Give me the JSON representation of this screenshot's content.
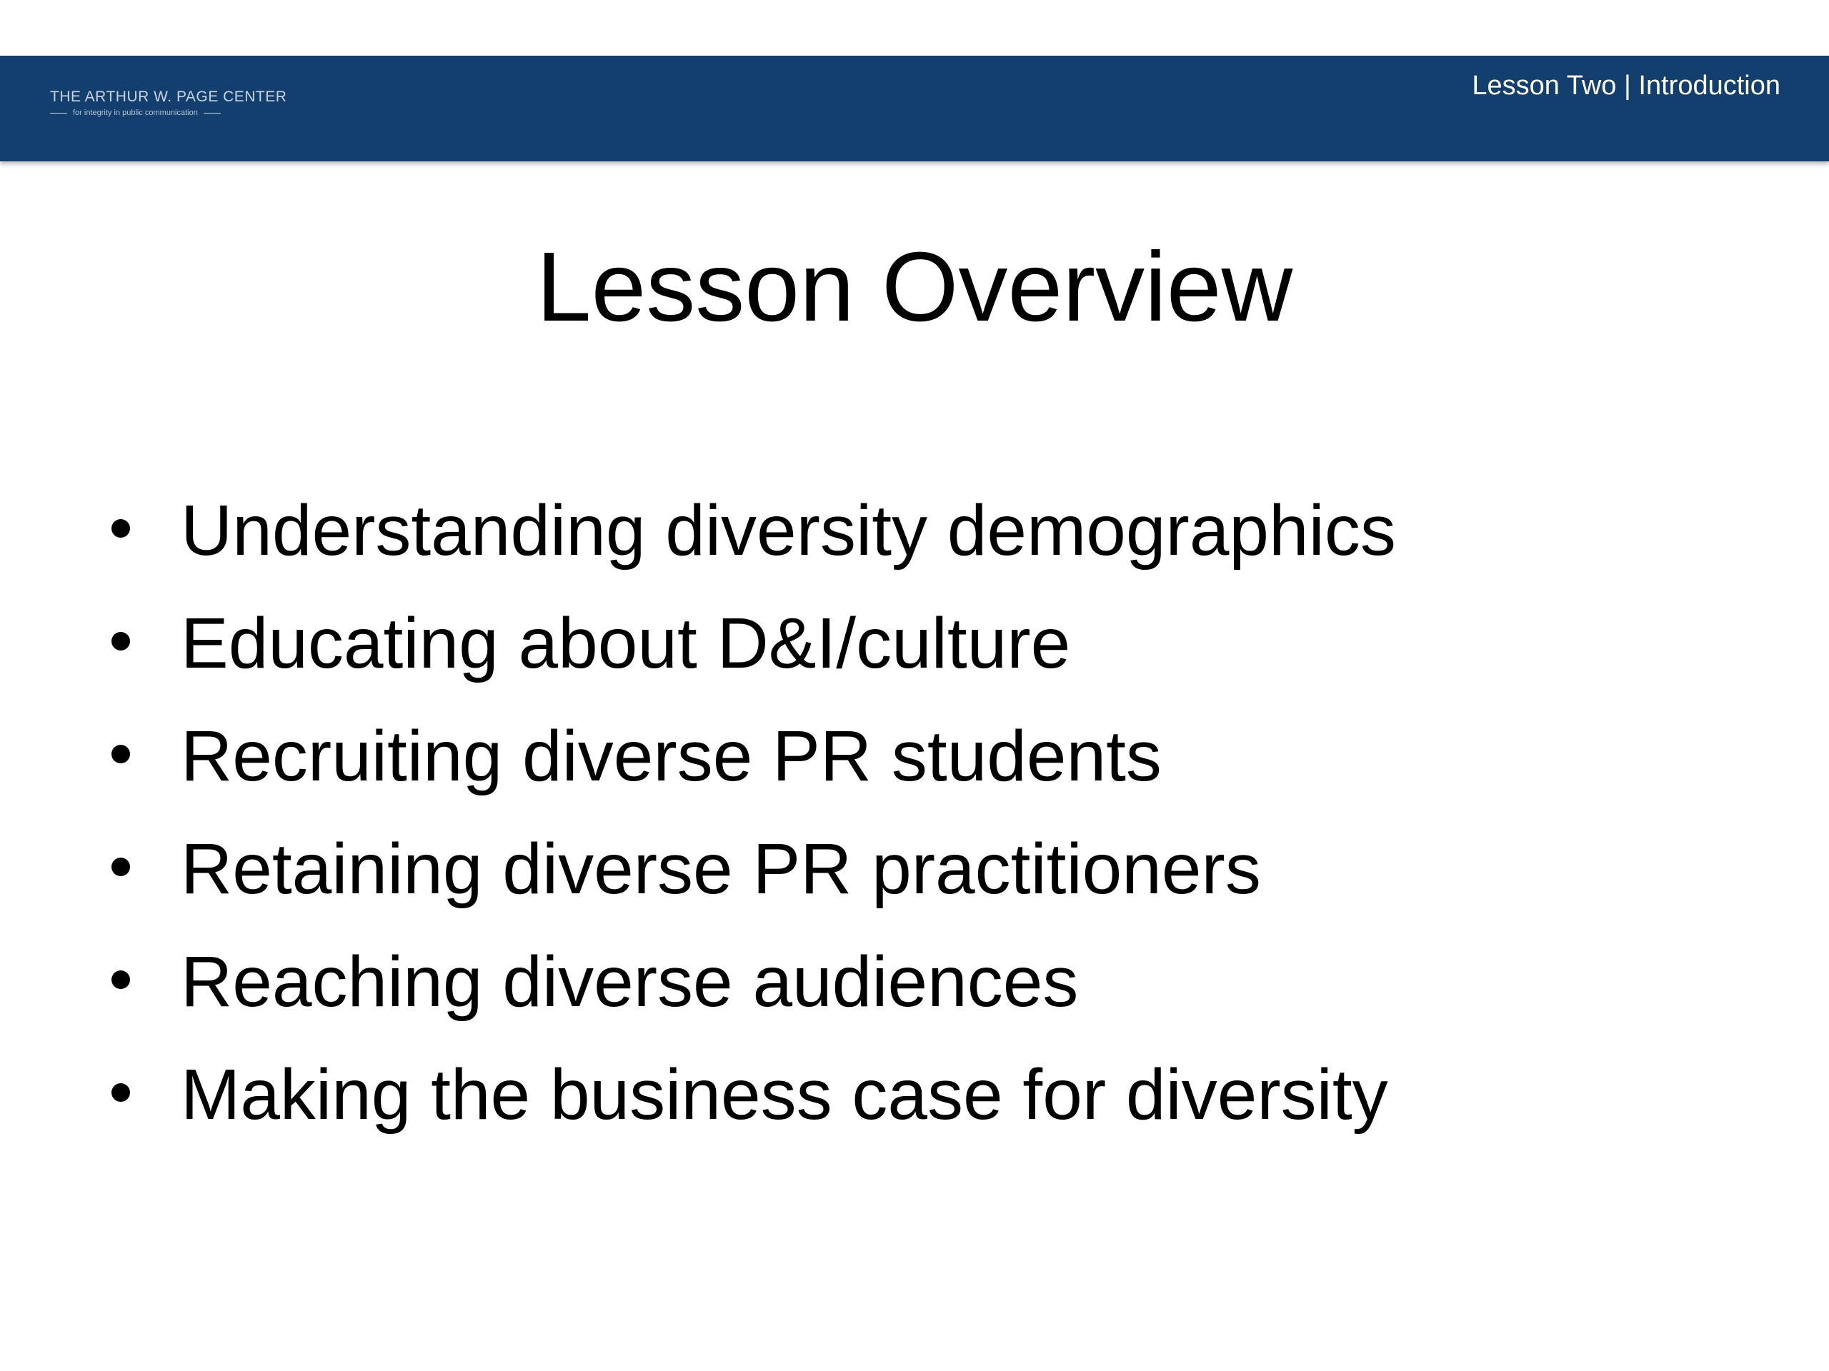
{
  "header": {
    "logo_name": "THE ARTHUR W. PAGE CENTER",
    "logo_tagline": "for integrity in public communication",
    "section_label": "Lesson Two | Introduction",
    "background_color": "#123f6e"
  },
  "slide": {
    "title": "Lesson Overview",
    "bullets": [
      "Understanding diversity demographics",
      "Educating about D&I/culture",
      "Recruiting diverse PR students",
      "Retaining diverse PR practitioners",
      "Reaching diverse audiences",
      "Making the business case for diversity"
    ]
  }
}
